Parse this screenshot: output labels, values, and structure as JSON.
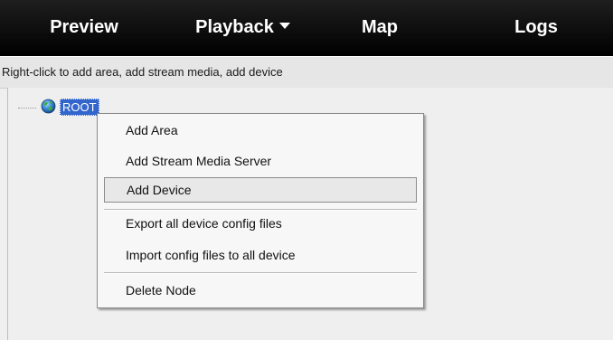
{
  "nav": {
    "preview": "Preview",
    "playback": "Playback",
    "map": "Map",
    "logs": "Logs"
  },
  "hint": "Right-click to add area, add stream media, add device",
  "tree": {
    "root_label": "ROOT"
  },
  "context_menu": {
    "items": [
      "Add Area",
      "Add Stream Media Server",
      "Add Device",
      "Export all device config files",
      "Import config files to all device",
      "Delete Node"
    ],
    "highlighted": "Add Device"
  },
  "colors": {
    "topbar": "#000000",
    "selection": "#3366cc",
    "menu_bg": "#f7f7f7"
  }
}
